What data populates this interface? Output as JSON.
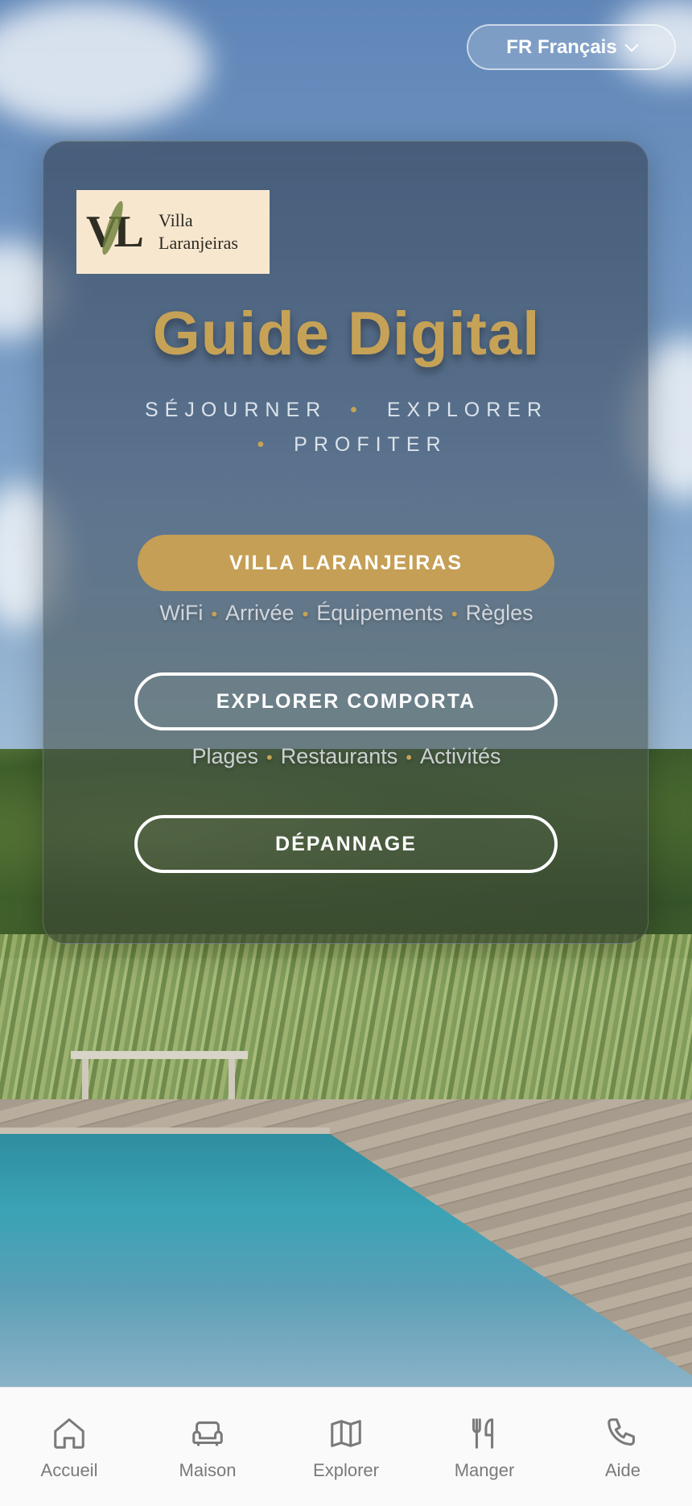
{
  "language": {
    "label": "FR Français"
  },
  "logo": {
    "monogram": "VL",
    "name_line1": "Villa",
    "name_line2": "Laranjeiras"
  },
  "title": "Guide Digital",
  "tagline": {
    "word1": "SÉJOURNER",
    "word2": "EXPLORER",
    "word3": "PROFITER",
    "separator": "•"
  },
  "buttons": {
    "villa": "VILLA LARANJEIRAS",
    "explore": "EXPLORER COMPORTA",
    "help": "DÉPANNAGE"
  },
  "villa_links": [
    "WiFi",
    "Arrivée",
    "Équipements",
    "Règles"
  ],
  "explore_links": [
    "Plages",
    "Restaurants",
    "Activités"
  ],
  "nav": [
    {
      "icon": "home-icon",
      "label": "Accueil"
    },
    {
      "icon": "sofa-icon",
      "label": "Maison"
    },
    {
      "icon": "map-icon",
      "label": "Explorer"
    },
    {
      "icon": "cutlery-icon",
      "label": "Manger"
    },
    {
      "icon": "phone-icon",
      "label": "Aide"
    }
  ],
  "colors": {
    "accent": "#c6a257",
    "button_gold": "#c59f55",
    "nav_bg": "#fafafa",
    "nav_text": "#7a7a7a"
  }
}
